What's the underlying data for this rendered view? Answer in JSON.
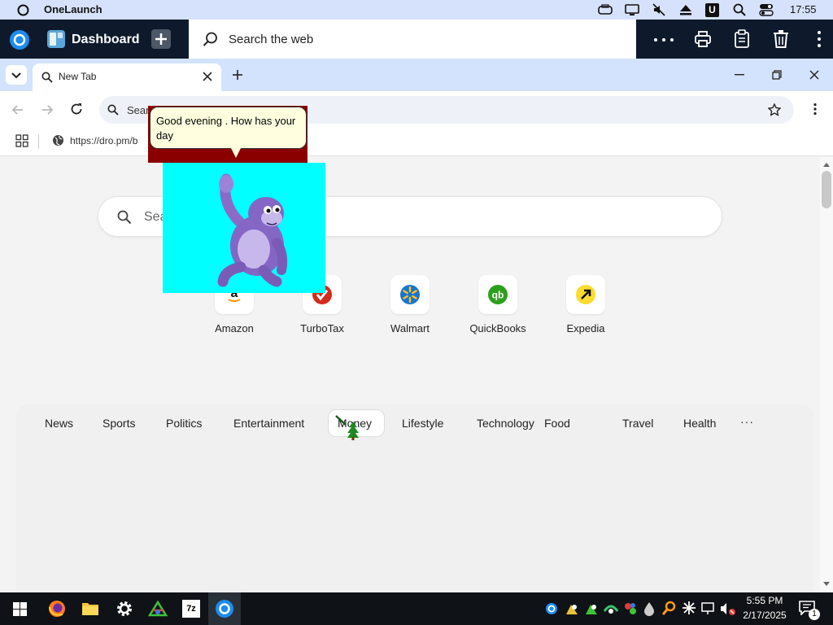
{
  "statusbar": {
    "app_name": "OneLaunch",
    "time": "17:55",
    "user_badge": "U"
  },
  "onelaunch": {
    "dashboard_label": "Dashboard",
    "search_placeholder": "Search the web"
  },
  "browser": {
    "tab_title": "New Tab",
    "omnibox_text": "Sear",
    "bookmark_url": "https://dro.pm/b"
  },
  "page": {
    "search_placeholder": "Sea",
    "shortcuts": [
      {
        "label": "Amazon",
        "icon": "amazon-icon"
      },
      {
        "label": "TurboTax",
        "icon": "turbotax-icon"
      },
      {
        "label": "Walmart",
        "icon": "walmart-icon"
      },
      {
        "label": "QuickBooks",
        "icon": "quickbooks-icon"
      },
      {
        "label": "Expedia",
        "icon": "expedia-icon"
      }
    ],
    "categories": [
      "News",
      "Sports",
      "Politics",
      "Entertainment",
      "Money",
      "Lifestyle",
      "Technology",
      "Food",
      "Travel",
      "Health"
    ],
    "selected_category": "Money",
    "more_label": "···"
  },
  "bonzi": {
    "speech": "Good evening . How has your day"
  },
  "taskbar": {
    "time": "5:55 PM",
    "date": "2/17/2025",
    "notification_count": "1"
  },
  "colors": {
    "onelaunch_dark": "#0e1a2c",
    "tabstrip": "#d3e3fd",
    "bonzi_bg": "#00ffff",
    "bubble_border": "#8a0000"
  }
}
